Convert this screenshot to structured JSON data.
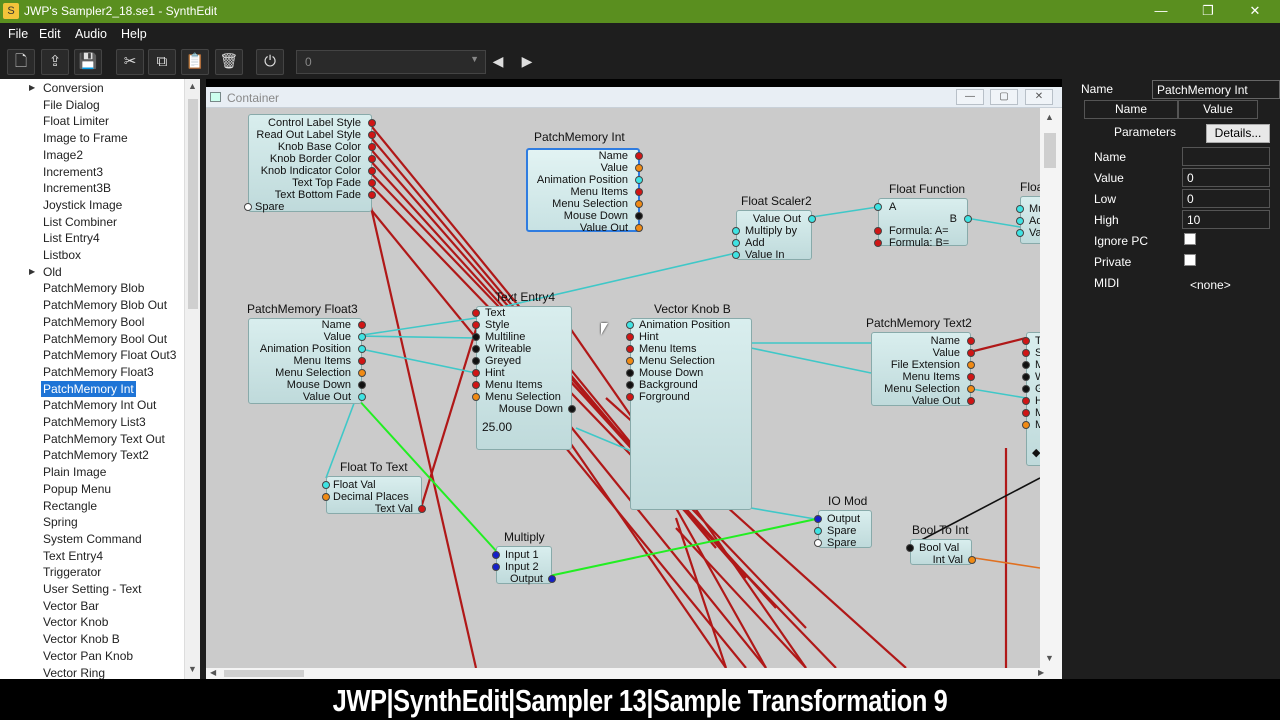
{
  "window": {
    "title": "JWP's Sampler2_18.se1 - SynthEdit",
    "minimize": "—",
    "restore": "❐",
    "close": "✕"
  },
  "menu": [
    "File",
    "Edit",
    "Audio",
    "Help"
  ],
  "toolbar": {
    "combo_value": "0"
  },
  "left_list": [
    {
      "label": "Conversion",
      "expander": true
    },
    {
      "label": "File Dialog"
    },
    {
      "label": "Float Limiter"
    },
    {
      "label": "Image to Frame"
    },
    {
      "label": "Image2"
    },
    {
      "label": "Increment3"
    },
    {
      "label": "Increment3B"
    },
    {
      "label": "Joystick Image"
    },
    {
      "label": "List Combiner"
    },
    {
      "label": "List Entry4"
    },
    {
      "label": "Listbox"
    },
    {
      "label": "Old",
      "expander": true
    },
    {
      "label": "PatchMemory Blob"
    },
    {
      "label": "PatchMemory Blob Out"
    },
    {
      "label": "PatchMemory Bool"
    },
    {
      "label": "PatchMemory Bool Out"
    },
    {
      "label": "PatchMemory Float Out3"
    },
    {
      "label": "PatchMemory Float3"
    },
    {
      "label": "PatchMemory Int",
      "selected": true
    },
    {
      "label": "PatchMemory Int Out"
    },
    {
      "label": "PatchMemory List3"
    },
    {
      "label": "PatchMemory Text Out"
    },
    {
      "label": "PatchMemory Text2"
    },
    {
      "label": "Plain Image"
    },
    {
      "label": "Popup Menu"
    },
    {
      "label": "Rectangle"
    },
    {
      "label": "Spring"
    },
    {
      "label": "System Command"
    },
    {
      "label": "Text Entry4"
    },
    {
      "label": "Triggerator"
    },
    {
      "label": "User Setting - Text"
    },
    {
      "label": "Vector Bar"
    },
    {
      "label": "Vector Knob"
    },
    {
      "label": "Vector Knob B"
    },
    {
      "label": "Vector Pan Knob"
    },
    {
      "label": "Vector Ring"
    }
  ],
  "container": {
    "title": "Container"
  },
  "modules": {
    "style_mod": {
      "pins": [
        "Control Label Style",
        "Read Out Label Style",
        "Knob Base Color",
        "Knob Border Color",
        "Knob Indicator Color",
        "Text Top Fade",
        "Text Bottom Fade"
      ],
      "spare": "Spare"
    },
    "pm_int": {
      "title": "PatchMemory Int",
      "pins": [
        "Name",
        "Value",
        "Animation Position",
        "Menu Items",
        "Menu Selection",
        "Mouse Down",
        "Value Out"
      ]
    },
    "float_scaler": {
      "title": "Float Scaler2",
      "out": "Value Out",
      "pins": [
        "Multiply by",
        "Add",
        "Value In"
      ]
    },
    "float_function": {
      "title": "Float Function",
      "a": "A",
      "b": "B",
      "pins": [
        "Formula: A=",
        "Formula: B="
      ]
    },
    "flo_partial": {
      "title": "Floa",
      "pins": [
        "Mu",
        "Ad",
        "Val"
      ]
    },
    "pm_float3": {
      "title": "PatchMemory Float3",
      "pins": [
        "Name",
        "Value",
        "Animation Position",
        "Menu Items",
        "Menu Selection",
        "Mouse Down",
        "Value Out"
      ]
    },
    "text_entry": {
      "title": "Text Entry4",
      "pins": [
        "Text",
        "Style",
        "Multiline",
        "Writeable",
        "Greyed",
        "Hint",
        "Menu Items",
        "Menu Selection"
      ],
      "out": "Mouse Down",
      "display": "25.00"
    },
    "vector_knob": {
      "title": "Vector Knob B",
      "pins": [
        "Animation Position",
        "Hint",
        "Menu Items",
        "Menu Selection",
        "Mouse Down",
        "Background",
        "Forground"
      ]
    },
    "pm_text2": {
      "title": "PatchMemory Text2",
      "pins": [
        "Name",
        "Value",
        "File Extension",
        "Menu Items",
        "Menu Selection",
        "Value Out"
      ]
    },
    "right_partial": {
      "pins": [
        "Te",
        "St",
        "M",
        "W",
        "Gr",
        "Hi",
        "M",
        "M"
      ],
      "bottom": "◆"
    },
    "float_to_text": {
      "title": "Float To Text",
      "pins": [
        "Float Val",
        "Decimal Places"
      ],
      "out": "Text Val"
    },
    "multiply": {
      "title": "Multiply",
      "pins": [
        "Input 1",
        "Input 2"
      ],
      "out": "Output"
    },
    "io_mod": {
      "title": "IO Mod",
      "pins": [
        "Output",
        "Spare",
        "Spare"
      ]
    },
    "bool_to_int": {
      "title": "Bool To Int",
      "in": "Bool Val",
      "out": "Int Val"
    }
  },
  "properties": {
    "name_label": "Name",
    "name_value": "PatchMemory Int",
    "col_name": "Name",
    "col_value": "Value",
    "tab_parameters": "Parameters",
    "tab_details": "Details...",
    "rows": [
      {
        "label": "Name",
        "value": ""
      },
      {
        "label": "Value",
        "value": "0"
      },
      {
        "label": "Low",
        "value": "0"
      },
      {
        "label": "High",
        "value": "10"
      }
    ],
    "ignore_pc": "Ignore PC",
    "private": "Private",
    "midi_label": "MIDI",
    "midi_value": "<none>"
  },
  "caption": "JWP|SynthEdit|Sampler 13|Sample Transformation 9",
  "colors": {
    "titlebar": "#5a8f1f",
    "selection": "#1e74d6",
    "wire_red": "#b01818",
    "wire_cyan": "#3fc8c8",
    "wire_green": "#22ee22"
  }
}
